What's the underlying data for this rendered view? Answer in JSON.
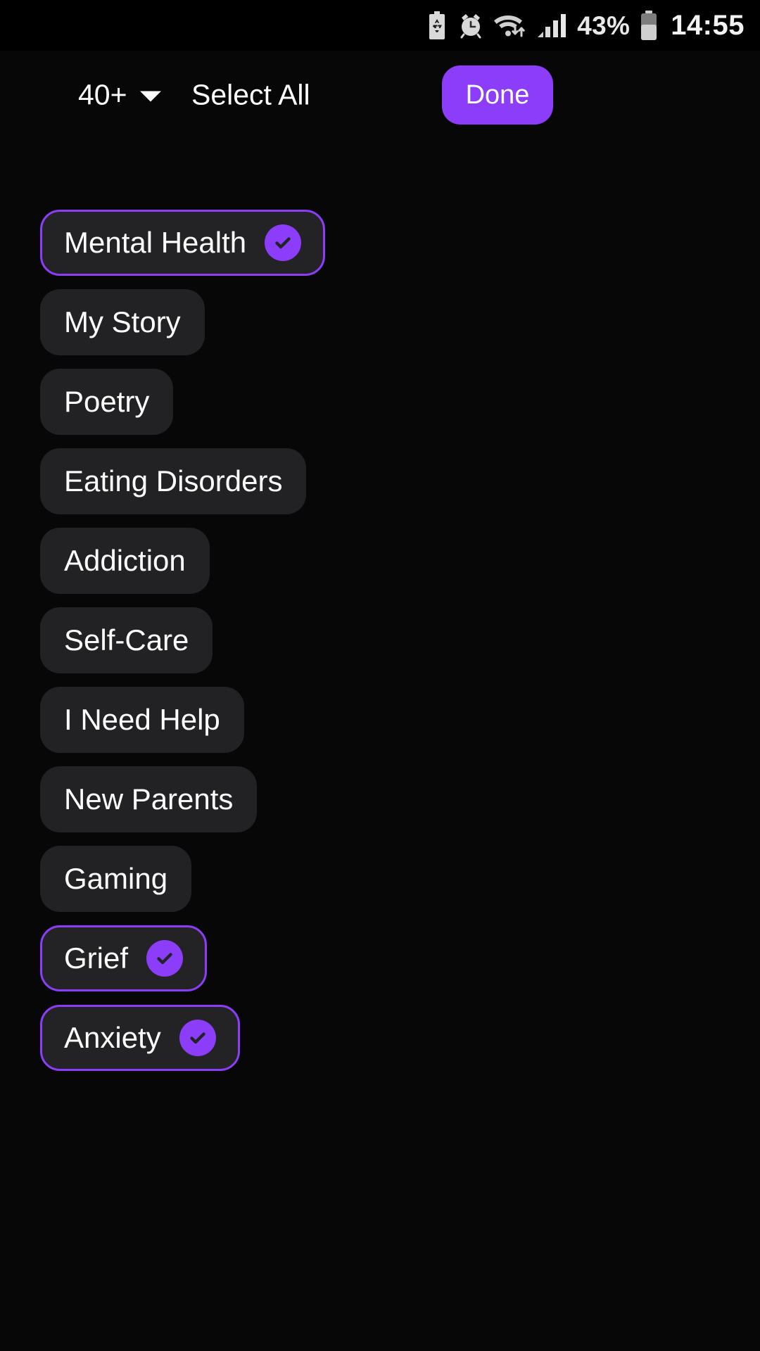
{
  "status_bar": {
    "icons": [
      {
        "name": "power-saving-battery-icon",
        "glyph": "battery-recycle"
      },
      {
        "name": "alarm-icon",
        "glyph": "alarm-clock"
      },
      {
        "name": "wifi-data-icon",
        "glyph": "wifi-arrows"
      },
      {
        "name": "cellular-signal-icon",
        "glyph": "signal-bars"
      }
    ],
    "battery_percent": "43%",
    "battery_icon_name": "battery-icon",
    "time": "14:55"
  },
  "header": {
    "age_filter_label": "40+",
    "age_filter_icon": "chevron-down-icon",
    "select_all_label": "Select All",
    "done_label": "Done"
  },
  "colors": {
    "accent": "#8b3dfa",
    "background": "#070708",
    "chip_background": "#222224",
    "text": "#ffffff"
  },
  "chips": [
    {
      "label": "Mental Health",
      "selected": true
    },
    {
      "label": "My Story",
      "selected": false
    },
    {
      "label": "Poetry",
      "selected": false
    },
    {
      "label": "Eating Disorders",
      "selected": false
    },
    {
      "label": "Addiction",
      "selected": false
    },
    {
      "label": "Self-Care",
      "selected": false
    },
    {
      "label": "I Need Help",
      "selected": false
    },
    {
      "label": "New Parents",
      "selected": false
    },
    {
      "label": "Gaming",
      "selected": false
    },
    {
      "label": "Grief",
      "selected": true
    },
    {
      "label": "Anxiety",
      "selected": true
    }
  ]
}
